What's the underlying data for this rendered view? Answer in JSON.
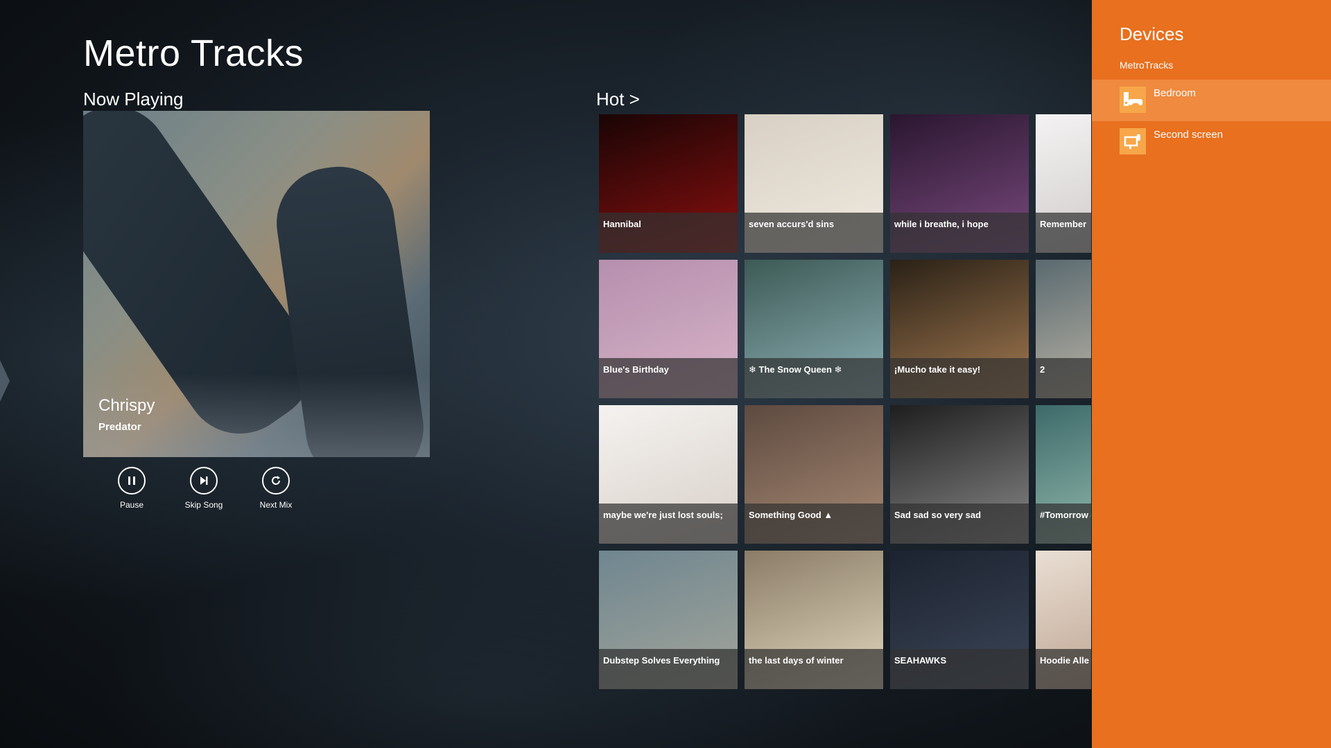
{
  "app": {
    "title": "Metro Tracks"
  },
  "now_playing": {
    "section_title": "Now Playing",
    "song": "Chrispy",
    "artist": "Predator",
    "controls": [
      {
        "label": "Pause",
        "icon": "pause-icon"
      },
      {
        "label": "Skip Song",
        "icon": "skip-icon"
      },
      {
        "label": "Next Mix",
        "icon": "refresh-icon"
      }
    ]
  },
  "hot": {
    "section_title": "Hot >",
    "tiles": [
      {
        "label": "Hannibal",
        "colors": [
          "#1a0505",
          "#8b0f0f"
        ]
      },
      {
        "label": "seven accurs'd sins",
        "colors": [
          "#d8d0c4",
          "#efe9df"
        ]
      },
      {
        "label": "while i breathe, i hope",
        "colors": [
          "#2a1630",
          "#7a4b7e"
        ]
      },
      {
        "label": "Remember",
        "colors": [
          "#f4f2f2",
          "#c9c4c4"
        ]
      },
      {
        "label": "Blue's Birthday",
        "colors": [
          "#b58fae",
          "#d8b4c7"
        ]
      },
      {
        "label": "❄ The Snow Queen ❄",
        "colors": [
          "#3d5a55",
          "#8fb2b8"
        ]
      },
      {
        "label": "¡Mucho take it easy!",
        "colors": [
          "#2a2116",
          "#a57b52"
        ]
      },
      {
        "label": "2",
        "colors": [
          "#5a6a70",
          "#c9bfae"
        ]
      },
      {
        "label": "maybe we're just lost souls;",
        "colors": [
          "#f4f2f0",
          "#d8cfc7"
        ]
      },
      {
        "label": "Something Good ▲",
        "colors": [
          "#5e4a40",
          "#a78a74"
        ]
      },
      {
        "label": "Sad sad so very sad",
        "colors": [
          "#1e1e1e",
          "#8a8a8a"
        ]
      },
      {
        "label": "#Tomorrow #Summer #",
        "colors": [
          "#3d6a6a",
          "#9fc4b6"
        ]
      },
      {
        "label": "Dubstep Solves Everything",
        "colors": [
          "#6f8690",
          "#a3a59a"
        ]
      },
      {
        "label": "the last days of winter",
        "colors": [
          "#8a7c66",
          "#e3d7bf"
        ]
      },
      {
        "label": "SEAHAWKS",
        "colors": [
          "#1c2330",
          "#3c4658"
        ]
      },
      {
        "label": "Hoodie Alle",
        "colors": [
          "#e9dfd4",
          "#b79a86"
        ]
      }
    ]
  },
  "devices": {
    "title": "Devices",
    "app_name": "MetroTracks",
    "items": [
      {
        "label": "Bedroom",
        "icon": "xbox-device-icon",
        "selected": true
      },
      {
        "label": "Second screen",
        "icon": "second-screen-icon",
        "selected": false
      }
    ]
  },
  "theme": {
    "panel": "#e8701e",
    "panel_selected": "#ef8a3f",
    "icon_bg": "#f7a64a"
  }
}
